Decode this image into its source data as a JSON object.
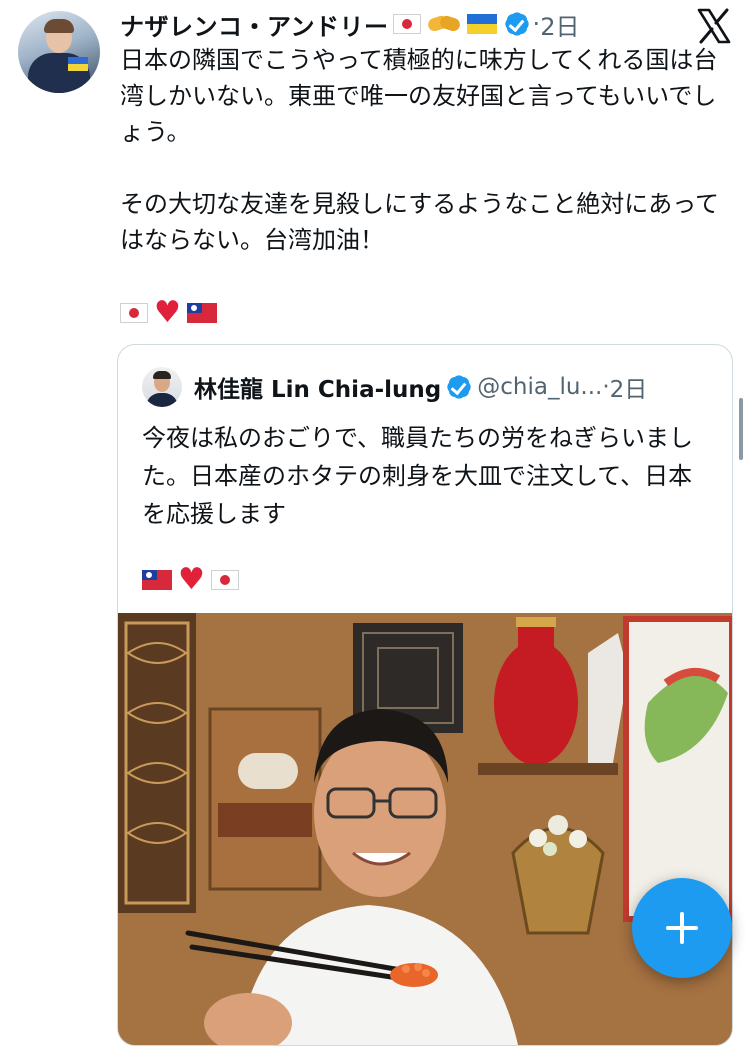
{
  "post": {
    "author_name": "ナザレンコ・アンドリー",
    "name_emojis": [
      "japan-flag",
      "handshake",
      "ukraine-flag"
    ],
    "separator": "·",
    "time": "2日",
    "text": "日本の隣国でこうやって積極的に味方してくれる国は台湾しかいない。東亜で唯一の友好国と言ってもいいでしょう。\n\nその大切な友達を見殺しにするようなこと絶対にあってはならない。台湾加油！",
    "emoji_row": [
      "japan-flag",
      "red-heart",
      "taiwan-flag"
    ]
  },
  "quote": {
    "author_name": "林佳龍 Lin Chia-lung",
    "handle": "@chia_lu...",
    "separator": "·",
    "time": "2日",
    "text": "今夜は私のおごりで、職員たちの労をねぎらいました。日本産のホタテの刺身を大皿で注文して、日本を応援します",
    "emoji_row": [
      "taiwan-flag",
      "red-heart",
      "japan-flag"
    ],
    "photo_icons": [
      "man-with-chopsticks",
      "red-vase",
      "flower-basket",
      "carved-wood-screen"
    ]
  },
  "app": {
    "logo_icon": "x-logo-icon",
    "compose_icon": "plus-icon"
  },
  "colors": {
    "accent": "#1d9bf0",
    "text": "#0f1419",
    "muted": "#536471",
    "border": "#cfd9de",
    "heart": "#e1213b"
  }
}
